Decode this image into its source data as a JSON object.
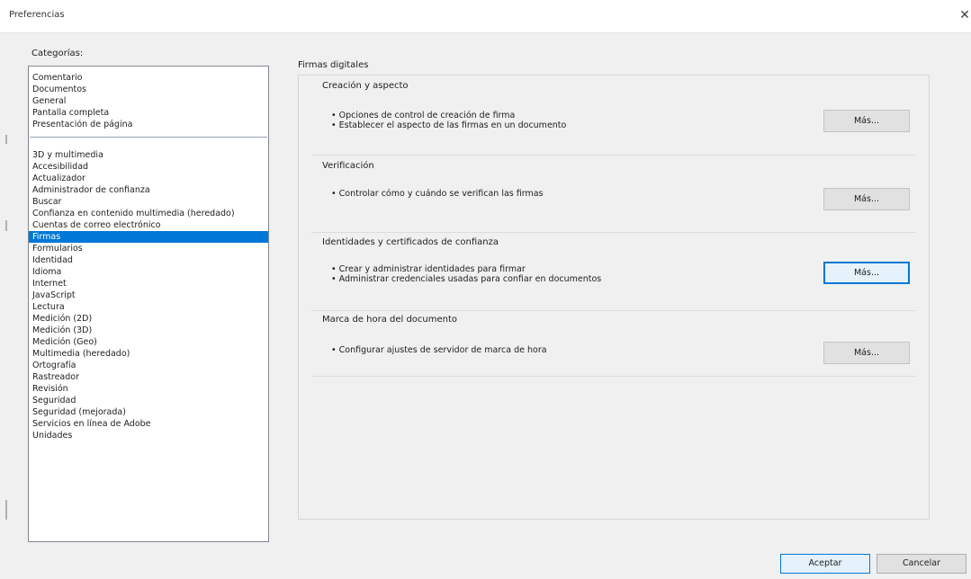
{
  "window": {
    "title": "Preferencias",
    "close_icon": "close-icon"
  },
  "categories": {
    "label": "Categorías:",
    "group1": [
      "Comentario",
      "Documentos",
      "General",
      "Pantalla completa",
      "Presentación de página"
    ],
    "group2": [
      "3D y multimedia",
      "Accesibilidad",
      "Actualizador",
      "Administrador de confianza",
      "Buscar",
      "Confianza en contenido multimedia (heredado)",
      "Cuentas de correo electrónico",
      "Firmas",
      "Formularios",
      "Identidad",
      "Idioma",
      "Internet",
      "JavaScript",
      "Lectura",
      "Medición (2D)",
      "Medición (3D)",
      "Medición (Geo)",
      "Multimedia (heredado)",
      "Ortografía",
      "Rastreador",
      "Revisión",
      "Seguridad",
      "Seguridad (mejorada)",
      "Servicios en línea de Adobe",
      "Unidades"
    ],
    "selected": "Firmas"
  },
  "panel": {
    "title": "Firmas digitales",
    "sections": [
      {
        "title": "Creación y aspecto",
        "bullets": [
          "• Opciones de control de creación de firma",
          "• Establecer el aspecto de las firmas en un documento"
        ],
        "button": "Más..."
      },
      {
        "title": "Verificación",
        "bullets": [
          "• Controlar cómo y cuándo se verifican las firmas"
        ],
        "button": "Más..."
      },
      {
        "title": "Identidades y certificados de confianza",
        "bullets": [
          "• Crear y administrar identidades para firmar",
          "• Administrar credenciales usadas para confiar en documentos"
        ],
        "button": "Más..."
      },
      {
        "title": "Marca de hora del documento",
        "bullets": [
          "• Configurar ajustes de servidor de marca de hora"
        ],
        "button": "Más..."
      }
    ]
  },
  "footer": {
    "ok_label": "Aceptar",
    "cancel_label": "Cancelar"
  },
  "colors": {
    "selection": "#0078d7",
    "window_bg": "#f0f0f0",
    "focus_border": "#0078d7"
  }
}
